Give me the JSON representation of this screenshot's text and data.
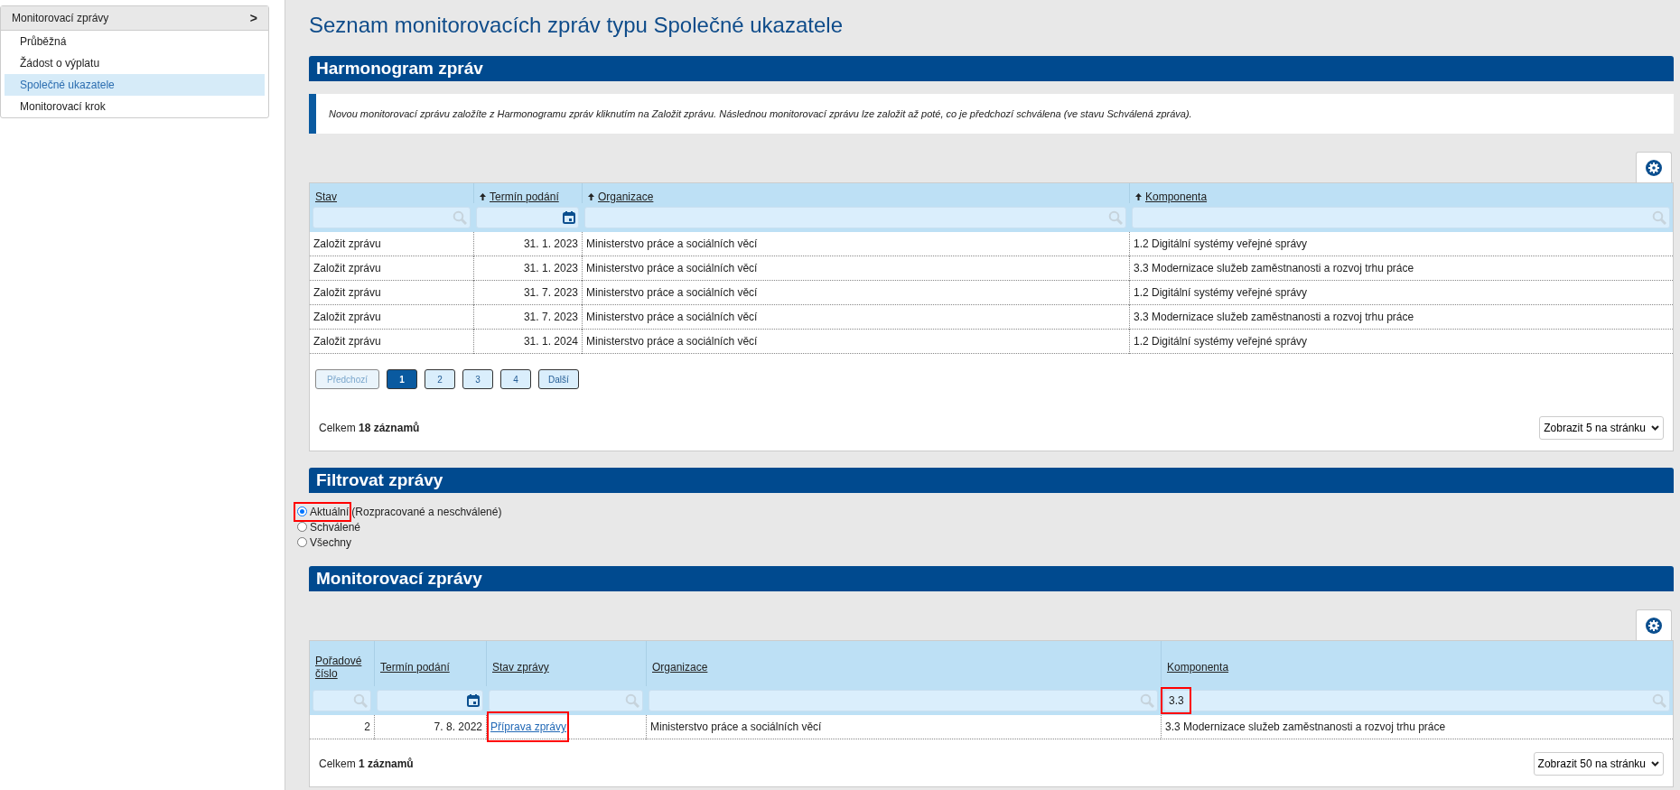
{
  "sidebar": {
    "menu_title": "Monitorovací zprávy",
    "menu_chevron": ">",
    "items": [
      {
        "label": "Průběžná",
        "selected": false
      },
      {
        "label": "Žádost o výplatu",
        "selected": false
      },
      {
        "label": "Společné ukazatele",
        "selected": true
      },
      {
        "label": "Monitorovací krok",
        "selected": false
      }
    ]
  },
  "page_title": "Seznam monitorovacích zpráv typu Společné ukazatele",
  "harmonogram": {
    "title": "Harmonogram zpráv",
    "info": "Novou monitorovací zprávu založíte z Harmonogramu zpráv kliknutím na Založit zprávu. Následnou monitorovací zprávu lze založit až poté, co je předchozí schválena (ve stavu Schválená zpráva).",
    "table": {
      "columns": [
        {
          "label": "Stav",
          "sort_arrow": false
        },
        {
          "label": "Termín podání",
          "sort_arrow": true
        },
        {
          "label": "Organizace",
          "sort_arrow": true
        },
        {
          "label": "Komponenta",
          "sort_arrow": true
        }
      ],
      "rows": [
        [
          "Založit zprávu",
          "31. 1. 2023",
          "Ministerstvo práce a sociálních věcí",
          "1.2 Digitální systémy veřejné správy"
        ],
        [
          "Založit zprávu",
          "31. 1. 2023",
          "Ministerstvo práce a sociálních věcí",
          "3.3 Modernizace služeb zaměstnanosti a rozvoj trhu práce"
        ],
        [
          "Založit zprávu",
          "31. 7. 2023",
          "Ministerstvo práce a sociálních věcí",
          "1.2 Digitální systémy veřejné správy"
        ],
        [
          "Založit zprávu",
          "31. 7. 2023",
          "Ministerstvo práce a sociálních věcí",
          "3.3 Modernizace služeb zaměstnanosti a rozvoj trhu práce"
        ],
        [
          "Založit zprávu",
          "31. 1. 2024",
          "Ministerstvo práce a sociálních věcí",
          "1.2 Digitální systémy veřejné správy"
        ]
      ]
    },
    "pagination": [
      {
        "label": "Předchozí",
        "selected": false,
        "disabled": true
      },
      {
        "label": "1",
        "selected": true,
        "disabled": false
      },
      {
        "label": "2",
        "selected": false,
        "disabled": false
      },
      {
        "label": "3",
        "selected": false,
        "disabled": false
      },
      {
        "label": "4",
        "selected": false,
        "disabled": false
      },
      {
        "label": "Další",
        "selected": false,
        "disabled": false
      }
    ],
    "total": "Celkem **18 záznamů**",
    "page_size": "Zobrazit 5 na stránku"
  },
  "filter": {
    "title": "Filtrovat zprávy",
    "options": [
      {
        "label": "Aktuální",
        "note": "(Rozpracované a neschválené)",
        "selected": true,
        "highlighted": true
      },
      {
        "label": "Schválené",
        "selected": false,
        "highlighted": false
      },
      {
        "label": "Všechny",
        "selected": false,
        "highlighted": false
      }
    ]
  },
  "monitoring": {
    "title": "Monitorovací zprávy",
    "table": {
      "columns": [
        {
          "label": "Pořadové číslo",
          "highlighted": false
        },
        {
          "label": "Termín podání",
          "highlighted": false
        },
        {
          "label": "Stav zprávy",
          "highlighted": false
        },
        {
          "label": "Organizace",
          "highlighted": false
        },
        {
          "label": "Komponenta",
          "filter_value": "3.3",
          "highlighted": true
        }
      ],
      "rows": [
        {
          "cells": [
            {
              "text": "2",
              "kind": "text",
              "highlighted": false
            },
            {
              "text": "7. 8. 2022",
              "kind": "text",
              "highlighted": false
            },
            {
              "text": "Příprava zprávy",
              "kind": "link",
              "highlighted": true
            },
            {
              "text": "Ministerstvo práce a sociálních věcí",
              "kind": "text",
              "highlighted": false
            },
            {
              "text": "3.3 Modernizace služeb zaměstnanosti a rozvoj trhu práce",
              "kind": "text",
              "highlighted": false
            }
          ]
        }
      ]
    },
    "total": "Celkem **1 záznamů**",
    "page_size": "Zobrazit 50 na stránku"
  }
}
